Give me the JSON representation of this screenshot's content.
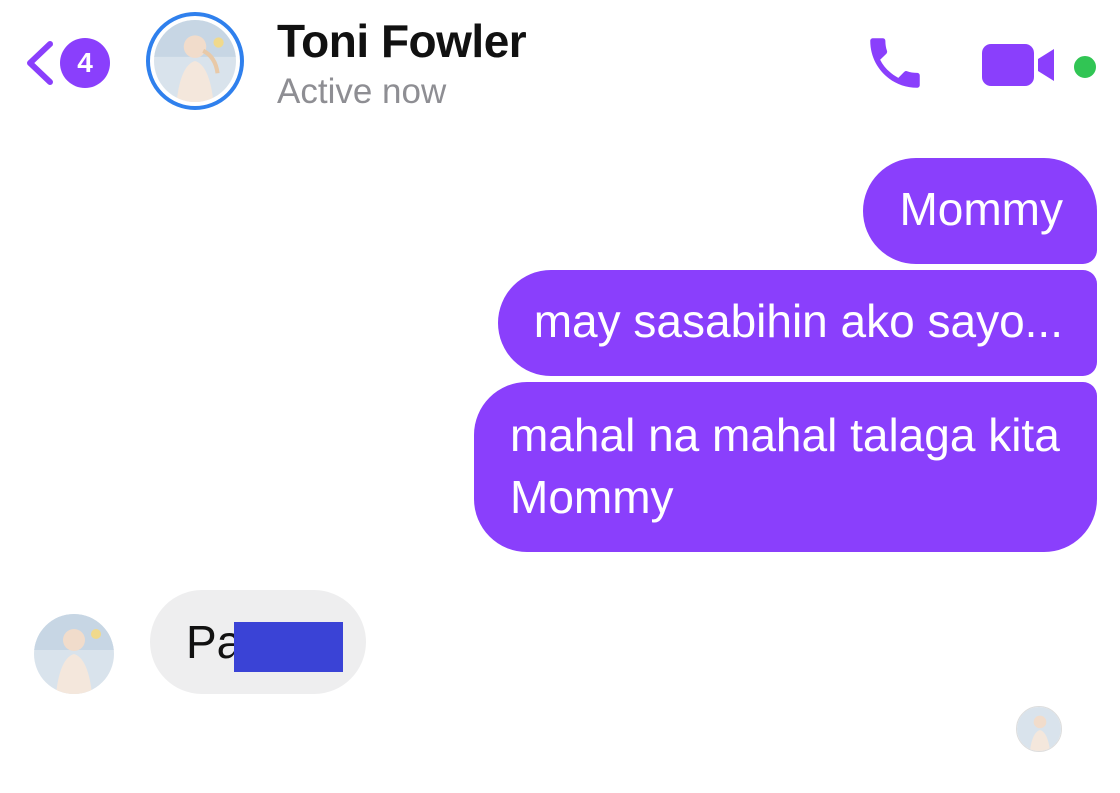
{
  "header": {
    "unread_count": "4",
    "contact_name": "Toni Fowler",
    "status": "Active now",
    "icons": {
      "back": "chevron-left-icon",
      "call": "phone-icon",
      "video": "video-camera-icon",
      "online": "online-status-dot"
    }
  },
  "messages": [
    {
      "sender": "me",
      "text": "Mommy"
    },
    {
      "sender": "me",
      "text": "may sasabihin ako sayo..."
    },
    {
      "sender": "me",
      "text": "mahal na mahal talaga kita Mommy"
    },
    {
      "sender": "contact",
      "text": "Pa",
      "redacted": true
    }
  ],
  "colors": {
    "accent": "#8a3ffc",
    "avatar_ring": "#2f80ed",
    "online": "#31c554",
    "incoming_bubble": "#eeeeef",
    "redaction": "#3a43d6",
    "status_text": "#8e8e93"
  }
}
